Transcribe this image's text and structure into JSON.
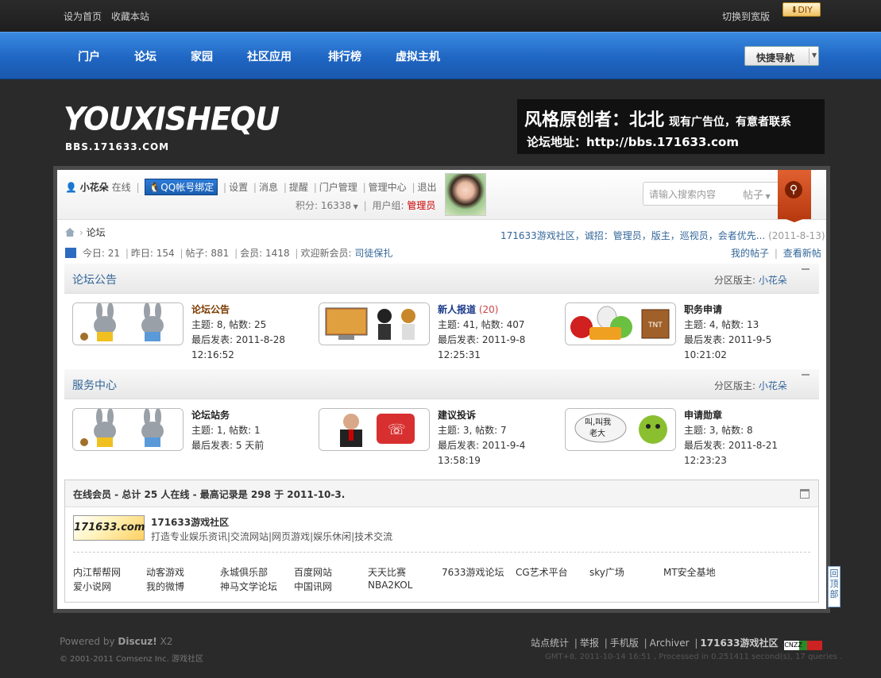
{
  "topbar": {
    "set_home": "设为首页",
    "bookmark": "收藏本站",
    "switch_width": "切换到宽版",
    "diy": "DIY"
  },
  "nav": {
    "items": [
      "门户",
      "论坛",
      "家园",
      "社区应用",
      "排行榜",
      "虚拟主机"
    ],
    "quick_nav": "快捷导航"
  },
  "header": {
    "logo_text": "YOUXISHEQU",
    "logo_sub": "BBS.171633.COM",
    "ad_line1": "风格原创者：北北",
    "ad_line1_small": "现有广告位，有意者联系",
    "ad_line2": "论坛地址：http://bbs.171633.com"
  },
  "user": {
    "name": "小花朵",
    "status": "在线",
    "qq_bind": "QQ帐号绑定",
    "links": [
      "设置",
      "消息",
      "提醒",
      "门户管理",
      "管理中心",
      "退出"
    ],
    "points_label": "积分:",
    "points": "16338",
    "group_label": "用户组:",
    "group": "管理员"
  },
  "search": {
    "placeholder": "请输入搜索内容",
    "type": "帖子"
  },
  "crumb": {
    "current": "论坛"
  },
  "announce": {
    "text": "171633游戏社区，诚招：管理员，版主，巡视员，会者优先...",
    "date": "(2011-8-13)"
  },
  "stats": {
    "today_label": "今日:",
    "today": "21",
    "yesterday_label": "昨日:",
    "yesterday": "154",
    "posts_label": "帖子:",
    "posts": "881",
    "members_label": "会员:",
    "members": "1418",
    "welcome_label": "欢迎新会员:",
    "newest": "司徒保扎",
    "my_posts": "我的帖子",
    "new_posts": "查看新帖"
  },
  "categories": [
    {
      "title": "论坛公告",
      "mod_label": "分区版主:",
      "mod": "小花朵",
      "forums": [
        {
          "name": "论坛公告",
          "new": "",
          "stats": "主题: 8, 帖数: 25",
          "last": "最后发表: 2011-8-28",
          "last2": "12:16:52"
        },
        {
          "name": "新人报道",
          "new": "(20)",
          "stats": "主题: 41, 帖数: 407",
          "last": "最后发表: 2011-9-8 12:25:31",
          "last2": ""
        },
        {
          "name": "职务申请",
          "new": "",
          "stats": "主题: 4, 帖数: 13",
          "last": "最后发表: 2011-9-5 10:21:02",
          "last2": ""
        }
      ]
    },
    {
      "title": "服务中心",
      "mod_label": "分区版主:",
      "mod": "小花朵",
      "forums": [
        {
          "name": "论坛站务",
          "new": "",
          "stats": "主题: 1, 帖数: 1",
          "last": "最后发表: 5 天前",
          "last2": ""
        },
        {
          "name": "建议投诉",
          "new": "",
          "stats": "主题: 3, 帖数: 7",
          "last": "最后发表: 2011-9-4 13:58:19",
          "last2": ""
        },
        {
          "name": "申请勋章",
          "new": "",
          "stats": "主题: 3, 帖数: 8",
          "last": "最后发表: 2011-8-21",
          "last2": "12:23:23"
        }
      ]
    }
  ],
  "online": {
    "title": "在线会员 - 总计 25 人在线 - 最高记录是 298 于 2011-10-3.",
    "site_logo": "171633.com",
    "site_name": "171633游戏社区",
    "site_desc": "打造专业娱乐资讯|交流网站|网页游戏|娱乐休闲|技术交流",
    "links_row1": [
      "内江帮帮网",
      "动客游戏",
      "永城俱乐部",
      "百度网站",
      "天天比赛",
      "7633游戏论坛",
      "CG艺术平台",
      "sky广场",
      "MT安全基地"
    ],
    "links_row2": [
      "爱小说网",
      "我的微博",
      "神马文学论坛",
      "中国讯网",
      "NBA2KOL"
    ]
  },
  "footer": {
    "powered": "Powered by",
    "brand": "Discuz!",
    "version": "X2",
    "copyright": "© 2001-2011 Comsenz Inc. 游戏社区",
    "links": [
      "站点统计",
      "举报",
      "手机版",
      "Archiver"
    ],
    "site": "171633游戏社区",
    "cnzz": "CNZZ",
    "info": "GMT+8, 2011-10-14 16:51 , Processed in 0.251411 second(s), 17 queries ."
  },
  "backtop": "回顶部"
}
